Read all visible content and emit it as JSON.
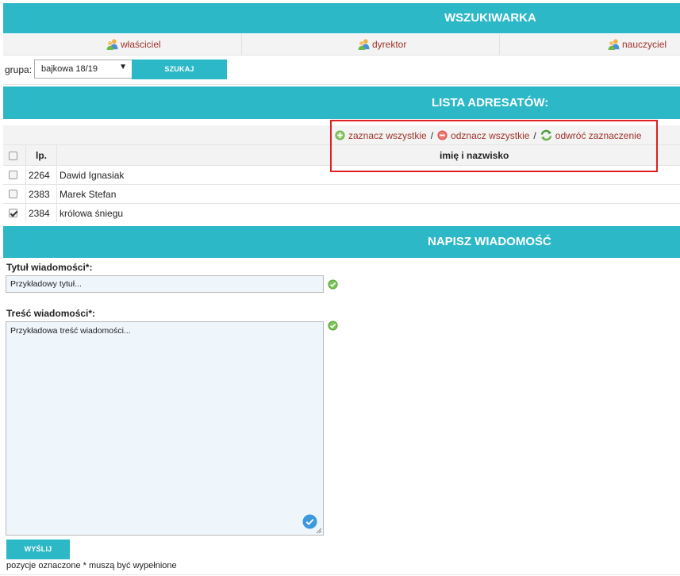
{
  "search": {
    "title": "WSZUKIWARKA",
    "roles": [
      "właściciel",
      "dyrektor",
      "nauczyciel"
    ],
    "group_label": "grupa:",
    "group_selected": "bajkowa 18/19",
    "search_button": "SZUKAJ"
  },
  "recipients": {
    "title": "LISTA ADRESATÓW:",
    "select_all": "zaznacz wszystkie",
    "deselect_all": "odznacz wszystkie",
    "invert_selection": "odwróć zaznaczenie",
    "separator": "/",
    "col_lp": "lp.",
    "col_name": "imię i nazwisko",
    "rows": [
      {
        "lp": "2264",
        "name": "Dawid Ignasiak",
        "checked": false
      },
      {
        "lp": "2383",
        "name": "Marek Stefan",
        "checked": false
      },
      {
        "lp": "2384",
        "name": "królowa śniegu",
        "checked": true
      }
    ]
  },
  "message": {
    "title": "NAPISZ WIADOMOŚĆ",
    "subject_label": "Tytuł wiadomości*:",
    "subject_value": "Przykładowy tytuł...",
    "body_label": "Treść wiadomości*:",
    "body_value": "Przykładowa treść wiadomości...",
    "send_button": "WYŚLIJ",
    "footnote": "pozycje oznaczone * muszą być wypełnione"
  },
  "colors": {
    "accent": "#2db8c7",
    "link": "#a0332b",
    "highlight_frame": "#e02020"
  },
  "icons": [
    "people-icon",
    "plus-circle-icon",
    "minus-circle-icon",
    "refresh-icon",
    "check-circle-icon",
    "blue-check-icon"
  ]
}
